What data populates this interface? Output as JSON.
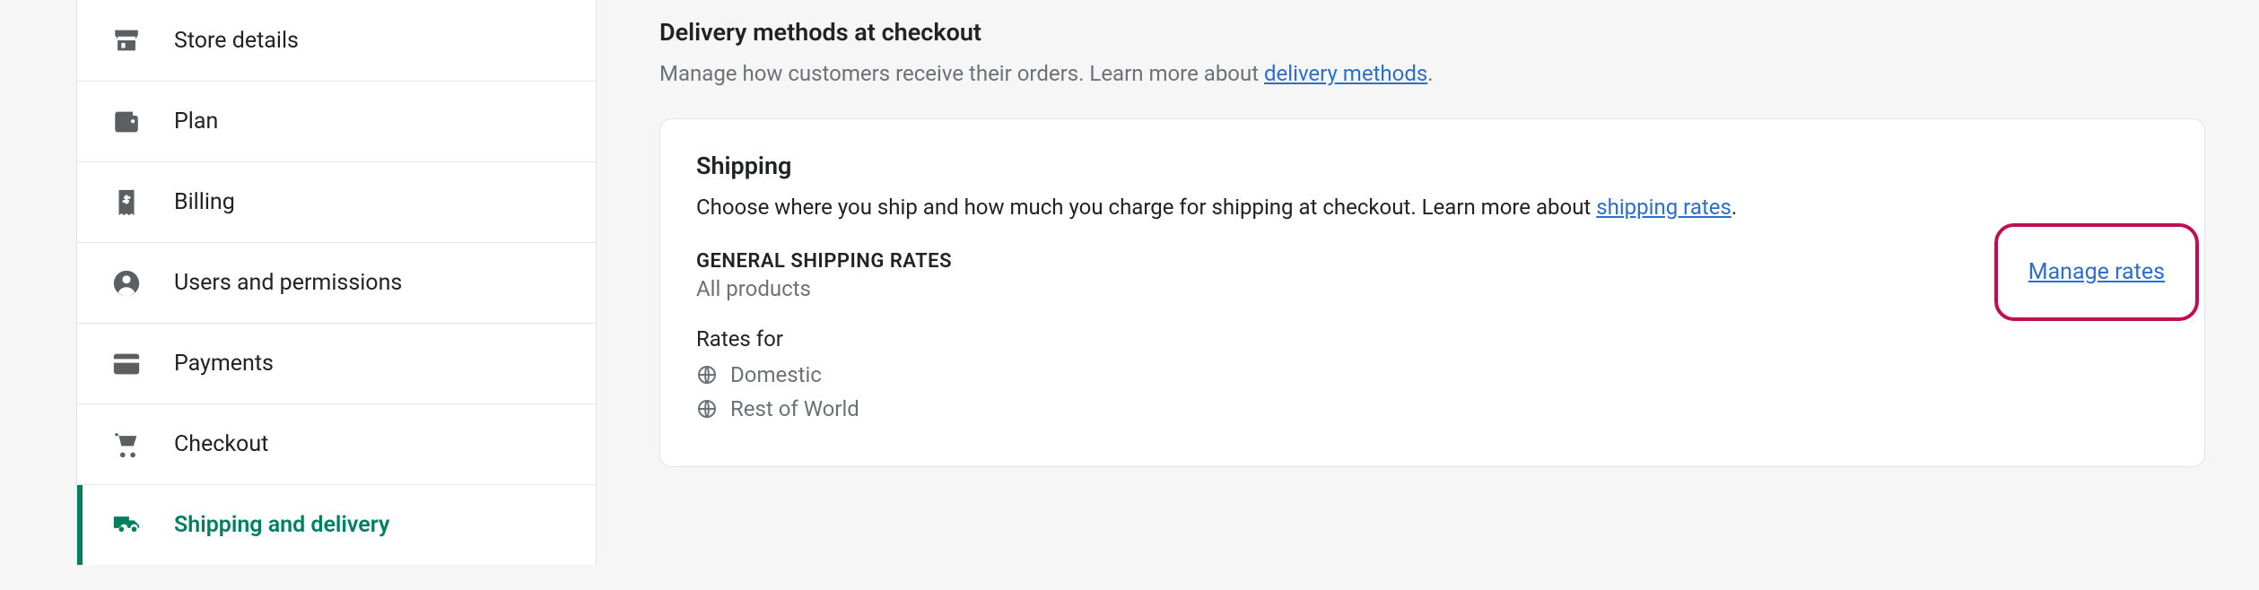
{
  "sidebar": {
    "items": [
      {
        "label": "Store details"
      },
      {
        "label": "Plan"
      },
      {
        "label": "Billing"
      },
      {
        "label": "Users and permissions"
      },
      {
        "label": "Payments"
      },
      {
        "label": "Checkout"
      },
      {
        "label": "Shipping and delivery"
      }
    ]
  },
  "main": {
    "section_title": "Delivery methods at checkout",
    "section_desc_prefix": "Manage how customers receive their orders. Learn more about ",
    "section_desc_link": "delivery methods",
    "section_desc_suffix": ".",
    "card": {
      "title": "Shipping",
      "desc_prefix": "Choose where you ship and how much you charge for shipping at checkout. Learn more about ",
      "desc_link": "shipping rates",
      "desc_suffix": ".",
      "general_heading": "GENERAL SHIPPING RATES",
      "general_sub": "All products",
      "rates_for_label": "Rates for",
      "rates": [
        {
          "label": "Domestic"
        },
        {
          "label": "Rest of World"
        }
      ],
      "manage_link": "Manage rates"
    }
  }
}
